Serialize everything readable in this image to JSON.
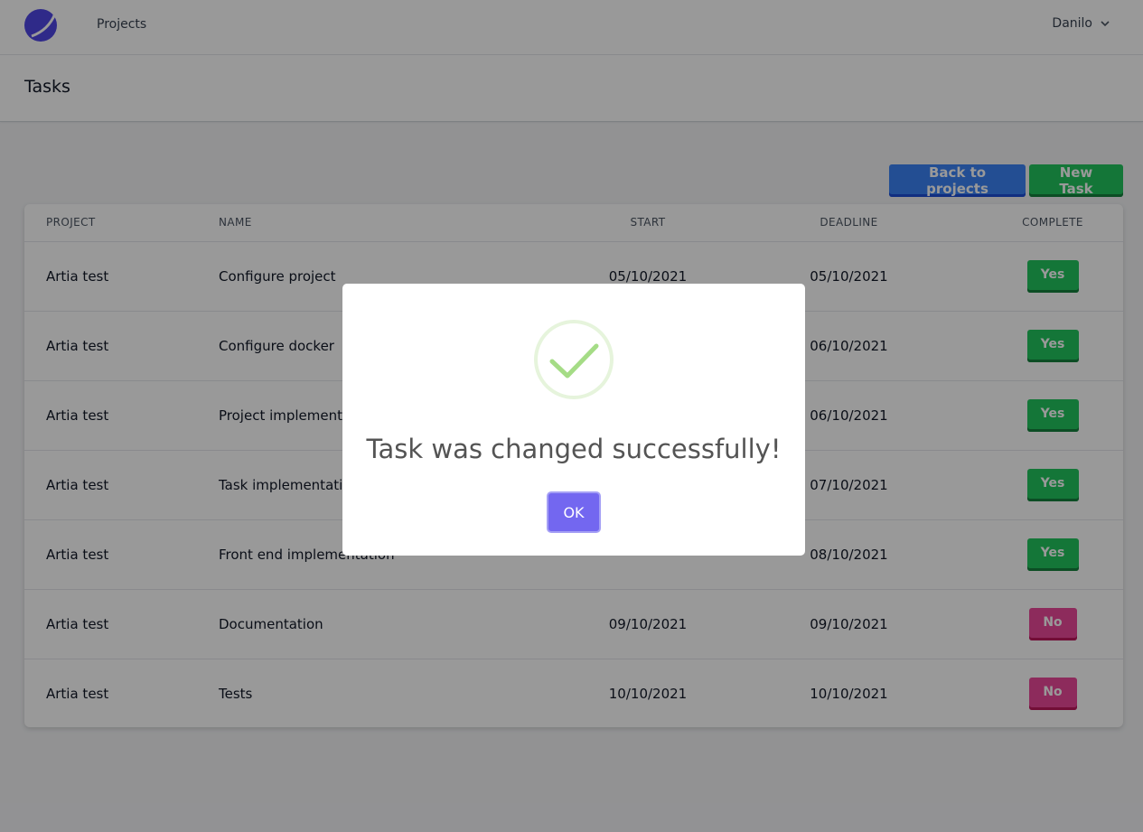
{
  "navbar": {
    "nav_link": "Projects",
    "user_name": "Danilo"
  },
  "page": {
    "title": "Tasks"
  },
  "actions": {
    "back_label": "Back to projects",
    "new_label": "New Task"
  },
  "table": {
    "headers": {
      "project": "PROJECT",
      "name": "NAME",
      "start": "START",
      "deadline": "DEADLINE",
      "complete": "COMPLETE"
    },
    "rows": [
      {
        "project": "Artia test",
        "name": "Configure project",
        "start": "05/10/2021",
        "deadline": "05/10/2021",
        "complete": "Yes"
      },
      {
        "project": "Artia test",
        "name": "Configure docker",
        "start": "",
        "deadline": "06/10/2021",
        "complete": "Yes"
      },
      {
        "project": "Artia test",
        "name": "Project implementa",
        "start": "",
        "deadline": "06/10/2021",
        "complete": "Yes"
      },
      {
        "project": "Artia test",
        "name": "Task implementatio",
        "start": "",
        "deadline": "07/10/2021",
        "complete": "Yes"
      },
      {
        "project": "Artia test",
        "name": "Front end implementation",
        "start": "",
        "deadline": "08/10/2021",
        "complete": "Yes"
      },
      {
        "project": "Artia test",
        "name": "Documentation",
        "start": "09/10/2021",
        "deadline": "09/10/2021",
        "complete": "No"
      },
      {
        "project": "Artia test",
        "name": "Tests",
        "start": "10/10/2021",
        "deadline": "10/10/2021",
        "complete": "No"
      }
    ]
  },
  "modal": {
    "title": "Task was changed successfully!",
    "ok_label": "OK"
  },
  "colors": {
    "primary_blue": "#3b82f6",
    "success_green": "#22c55e",
    "danger_pink": "#ec4899",
    "modal_button": "#7367f0",
    "success_icon": "#a5dc86"
  },
  "icons": {
    "logo": "logo-icon",
    "user_dropdown": "chevron-down-icon",
    "modal_status": "success-check-icon"
  }
}
